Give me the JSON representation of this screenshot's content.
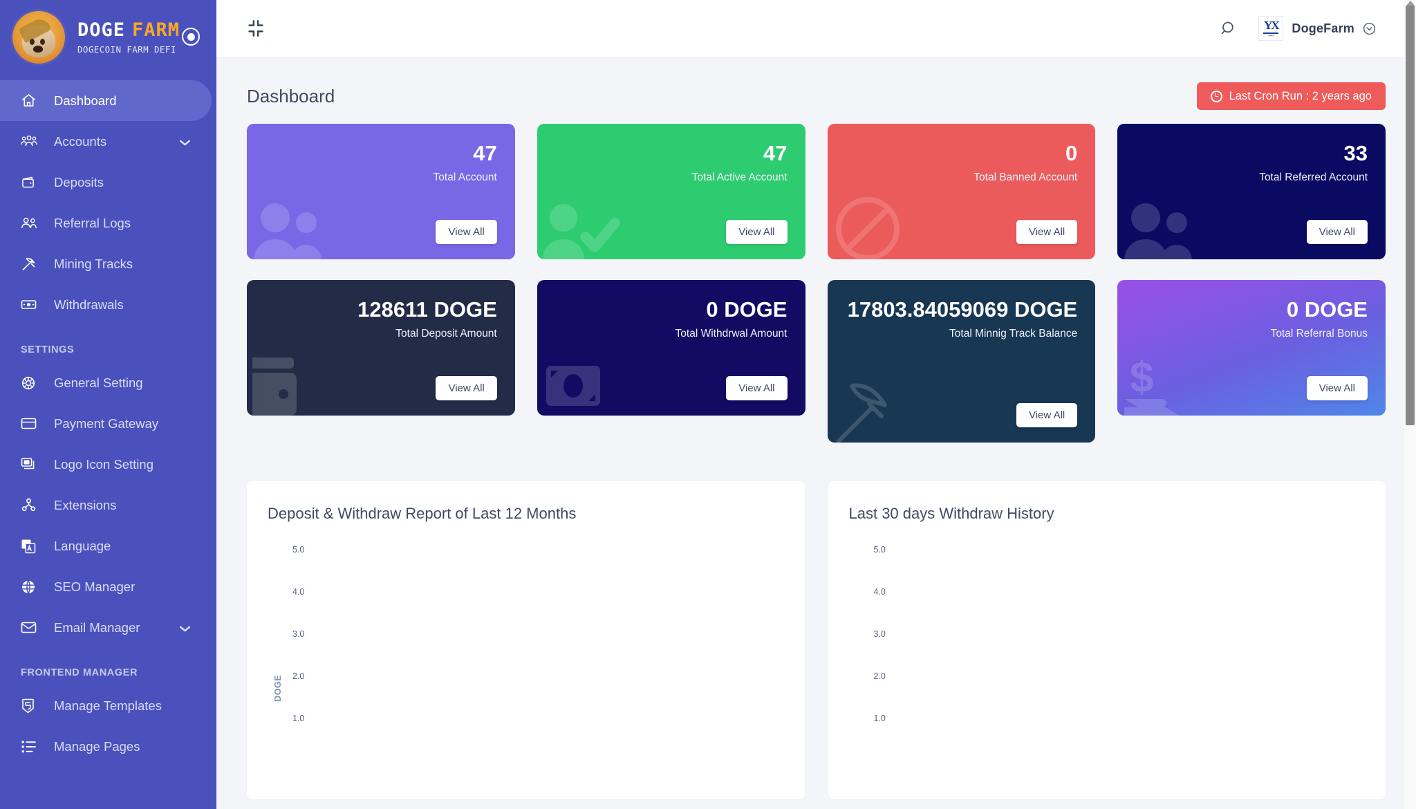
{
  "brand": {
    "title_primary": "DOGE",
    "title_accent": "FARM",
    "subtitle": "DOGECOIN FARM DEFI"
  },
  "sidebar": {
    "items": [
      {
        "label": "Dashboard",
        "icon": "home-icon",
        "active": true,
        "chevron": false
      },
      {
        "label": "Accounts",
        "icon": "users-gear-icon",
        "active": false,
        "chevron": true
      },
      {
        "label": "Deposits",
        "icon": "wallet-icon",
        "active": false,
        "chevron": false
      },
      {
        "label": "Referral Logs",
        "icon": "people-icon",
        "active": false,
        "chevron": false
      },
      {
        "label": "Mining Tracks",
        "icon": "pickaxe-icon",
        "active": false,
        "chevron": false
      },
      {
        "label": "Withdrawals",
        "icon": "banknote-icon",
        "active": false,
        "chevron": false
      }
    ],
    "section_settings": "SETTINGS",
    "settings_items": [
      {
        "label": "General Setting",
        "icon": "gear-circle-icon",
        "chevron": false
      },
      {
        "label": "Payment Gateway",
        "icon": "credit-card-icon",
        "chevron": false
      },
      {
        "label": "Logo Icon Setting",
        "icon": "images-icon",
        "chevron": false
      },
      {
        "label": "Extensions",
        "icon": "sitemap-icon",
        "chevron": false
      },
      {
        "label": "Language",
        "icon": "language-icon",
        "chevron": false
      },
      {
        "label": "SEO Manager",
        "icon": "globe-icon",
        "chevron": false
      },
      {
        "label": "Email Manager",
        "icon": "envelope-icon",
        "chevron": true
      }
    ],
    "section_frontend": "FRONTEND MANAGER",
    "frontend_items": [
      {
        "label": "Manage Templates",
        "icon": "html5-icon",
        "chevron": false
      },
      {
        "label": "Manage Pages",
        "icon": "list-ul-icon",
        "chevron": false
      }
    ]
  },
  "topbar": {
    "collapse_icon": "compress-icon",
    "search_icon": "search-icon",
    "profile_name": "DogeFarm",
    "profile_chevron_icon": "chevron-down-circle-icon",
    "avatar_icon": "company-logo-avatar"
  },
  "page": {
    "title": "Dashboard",
    "cron_label": "Last Cron Run : 2 years ago",
    "cron_icon": "clock-icon",
    "cron_color": "#ef5a5a"
  },
  "stat_cards_row1": [
    {
      "value": "47",
      "label": "Total Account",
      "button": "View All",
      "color": "#7868e6",
      "bg_icon": "users-icon"
    },
    {
      "value": "47",
      "label": "Total Active Account",
      "button": "View All",
      "color": "#2ecc71",
      "bg_icon": "user-check-icon"
    },
    {
      "value": "0",
      "label": "Total Banned Account",
      "button": "View All",
      "color": "#ec5b5b",
      "bg_icon": "ban-icon"
    },
    {
      "value": "33",
      "label": "Total Referred Account",
      "button": "View All",
      "color": "#0a0a63",
      "bg_icon": "users-icon"
    }
  ],
  "stat_cards_row2": [
    {
      "value": "128611 DOGE",
      "label": "Total Deposit Amount",
      "button": "View All",
      "color": "#222c46",
      "bg_icon": "wallet-icon"
    },
    {
      "value": "0 DOGE",
      "label": "Total Withdrwal Amount",
      "button": "View All",
      "color": "#120a63",
      "bg_icon": "money-bill-icon"
    },
    {
      "value": "17803.84059069 DOGE",
      "label": "Total Minnig Track Balance",
      "button": "View All",
      "color": "#173753",
      "bg_icon": "hammer-icon"
    },
    {
      "value": "0 DOGE",
      "label": "Total Referral Bonus",
      "button": "View All",
      "color": "#8b4fe8",
      "bg_icon": "hand-dollar-icon"
    }
  ],
  "chart_data": [
    {
      "type": "line",
      "title": "Deposit & Withdraw Report of Last 12 Months",
      "xlabel": "",
      "ylabel": "DOGE",
      "categories": [],
      "series": [],
      "yticks": [
        "5.0",
        "4.0",
        "3.0",
        "2.0",
        "1.0"
      ],
      "ylim": [
        1.0,
        5.0
      ],
      "grid": false,
      "legend": "none"
    },
    {
      "type": "line",
      "title": "Last 30 days Withdraw History",
      "xlabel": "",
      "ylabel": "",
      "categories": [],
      "series": [],
      "yticks": [
        "5.0",
        "4.0",
        "3.0",
        "2.0",
        "1.0"
      ],
      "ylim": [
        1.0,
        5.0
      ],
      "grid": false,
      "legend": "none"
    }
  ]
}
